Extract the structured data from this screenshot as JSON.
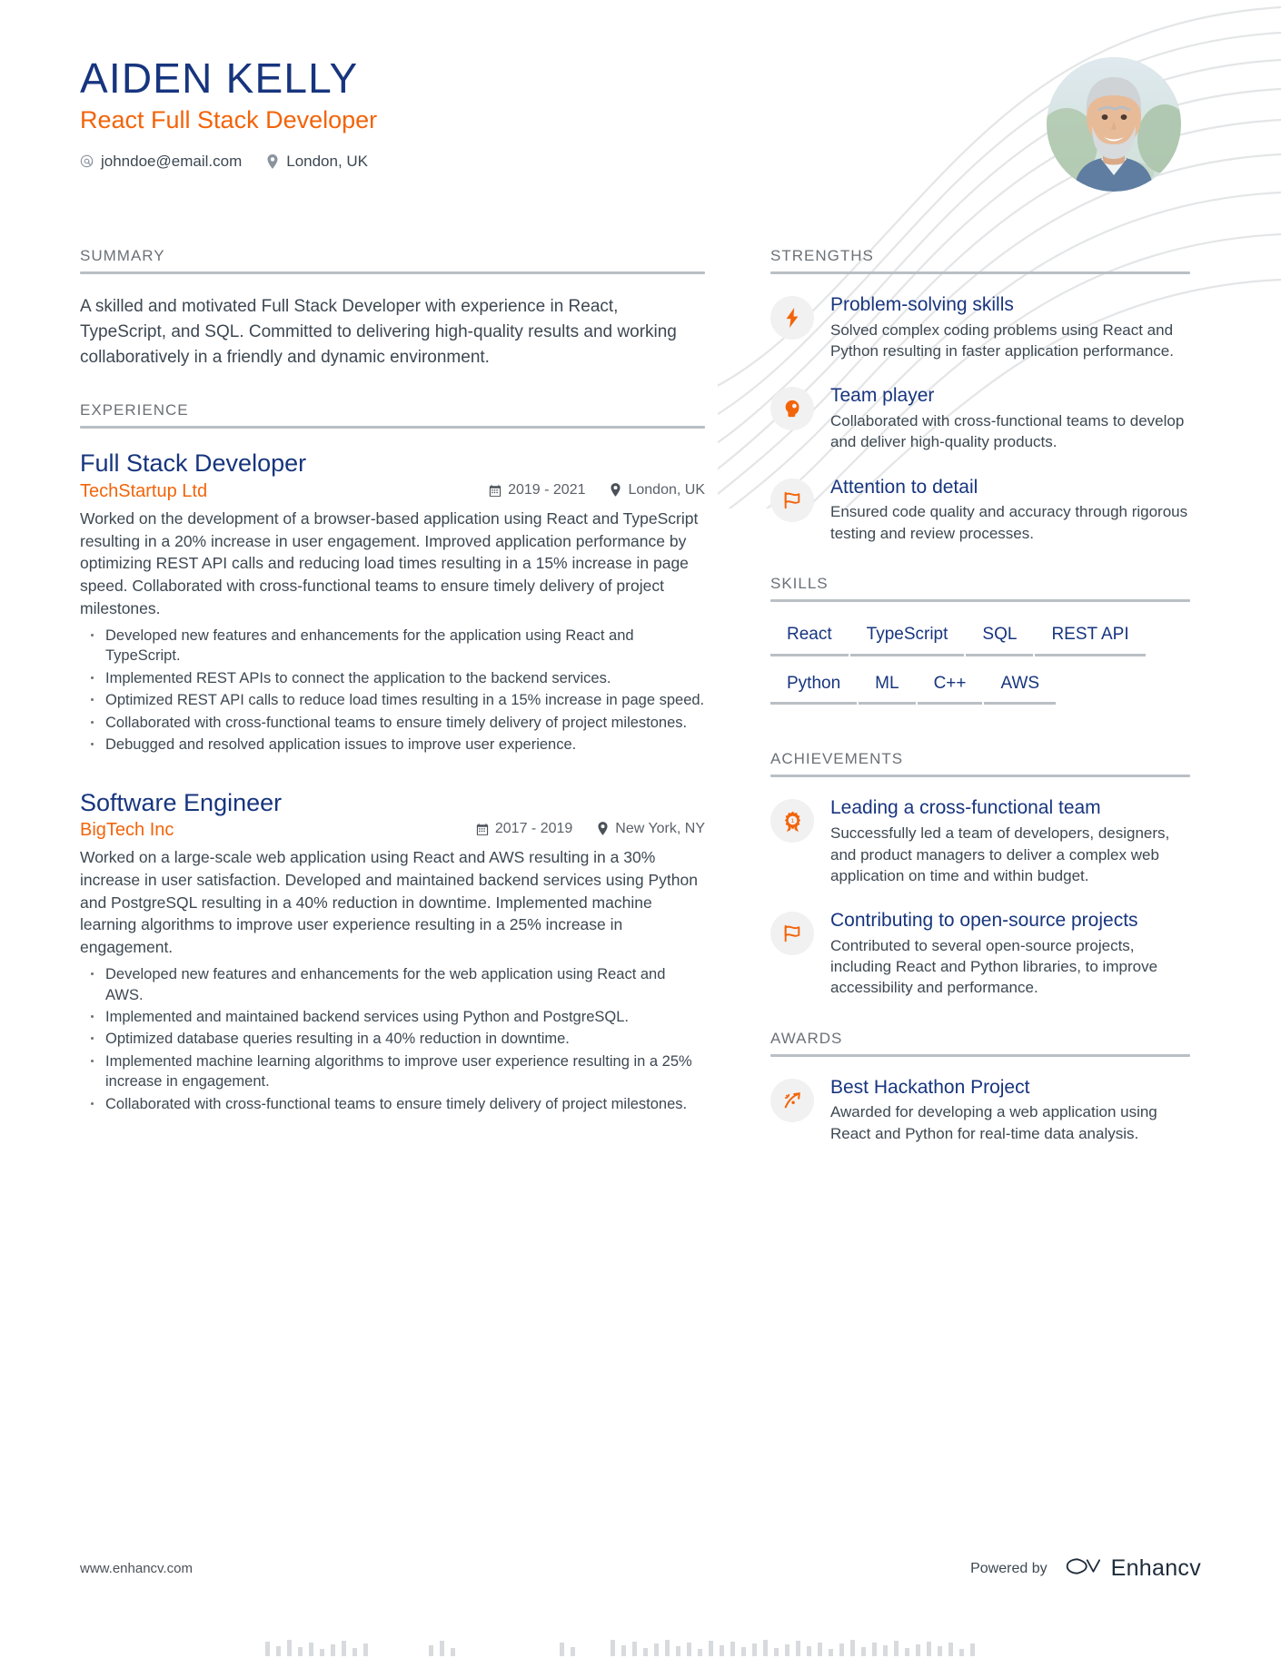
{
  "header": {
    "name": "AIDEN KELLY",
    "role": "React Full Stack Developer",
    "email": "johndoe@email.com",
    "location": "London, UK",
    "email_icon": "at-icon",
    "location_icon": "map-pin-icon",
    "photo_alt": "profile-photo"
  },
  "colors": {
    "navy": "#17357e",
    "orange": "#f2640a",
    "body_text": "#3d4852",
    "rule": "#b9bfc4",
    "section_label": "#6b7178"
  },
  "summary": {
    "title": "SUMMARY",
    "text": "A skilled and motivated Full Stack Developer with experience in React, TypeScript, and SQL. Committed to delivering high-quality results and working collaboratively in a friendly and dynamic environment."
  },
  "experience": {
    "title": "EXPERIENCE",
    "jobs": [
      {
        "position": "Full Stack Developer",
        "company": "TechStartup Ltd",
        "dates": "2019 - 2021",
        "location": "London, UK",
        "date_icon": "calendar-icon",
        "location_icon": "map-pin-icon",
        "description": "Worked on the development of a browser-based application using React and TypeScript resulting in a 20% increase in user engagement. Improved application performance by optimizing REST API calls and reducing load times resulting in a 15% increase in page speed. Collaborated with cross-functional teams to ensure timely delivery of project milestones.",
        "bullets": [
          "Developed new features and enhancements for the application using React and TypeScript.",
          "Implemented REST APIs to connect the application to the backend services.",
          "Optimized REST API calls to reduce load times resulting in a 15% increase in page speed.",
          "Collaborated with cross-functional teams to ensure timely delivery of project milestones.",
          "Debugged and resolved application issues to improve user experience."
        ]
      },
      {
        "position": "Software Engineer",
        "company": "BigTech Inc",
        "dates": "2017 - 2019",
        "location": "New York, NY",
        "date_icon": "calendar-icon",
        "location_icon": "map-pin-icon",
        "description": "Worked on a large-scale web application using React and AWS resulting in a 30% increase in user satisfaction. Developed and maintained backend services using Python and PostgreSQL resulting in a 40% reduction in downtime. Implemented machine learning algorithms to improve user experience resulting in a 25% increase in engagement.",
        "bullets": [
          "Developed new features and enhancements for the web application using React and AWS.",
          "Implemented and maintained backend services using Python and PostgreSQL.",
          "Optimized database queries resulting in a 40% reduction in downtime.",
          "Implemented machine learning algorithms to improve user experience resulting in a 25% increase in engagement.",
          "Collaborated with cross-functional teams to ensure timely delivery of project milestones."
        ]
      }
    ]
  },
  "strengths": {
    "title": "STRENGTHS",
    "items": [
      {
        "icon": "lightning-bolt-icon",
        "title": "Problem-solving skills",
        "desc": "Solved complex coding problems using React and Python resulting in faster application performance."
      },
      {
        "icon": "person-head-icon",
        "title": "Team player",
        "desc": "Collaborated with cross-functional teams to develop and deliver high-quality products."
      },
      {
        "icon": "flag-icon",
        "title": "Attention to detail",
        "desc": "Ensured code quality and accuracy through rigorous testing and review processes."
      }
    ]
  },
  "skills": {
    "title": "SKILLS",
    "items": [
      "React",
      "TypeScript",
      "SQL",
      "REST API",
      "Python",
      "ML",
      "C++",
      "AWS"
    ]
  },
  "achievements": {
    "title": "ACHIEVEMENTS",
    "items": [
      {
        "icon": "award-medal-icon",
        "title": "Leading a cross-functional team",
        "desc": "Successfully led a team of developers, designers, and product managers to deliver a complex web application on time and within budget."
      },
      {
        "icon": "flag-icon",
        "title": "Contributing to open-source projects",
        "desc": "Contributed to several open-source projects, including React and Python libraries, to improve accessibility and performance."
      }
    ]
  },
  "awards": {
    "title": "AWARDS",
    "items": [
      {
        "icon": "trending-arrow-icon",
        "title": "Best Hackathon Project",
        "desc": "Awarded for developing a web application using React and Python for real-time data analysis."
      }
    ]
  },
  "footer": {
    "site": "www.enhancv.com",
    "powered_by": "Powered by",
    "brand": "Enhancv",
    "brand_icon": "enhancv-logo-icon"
  }
}
